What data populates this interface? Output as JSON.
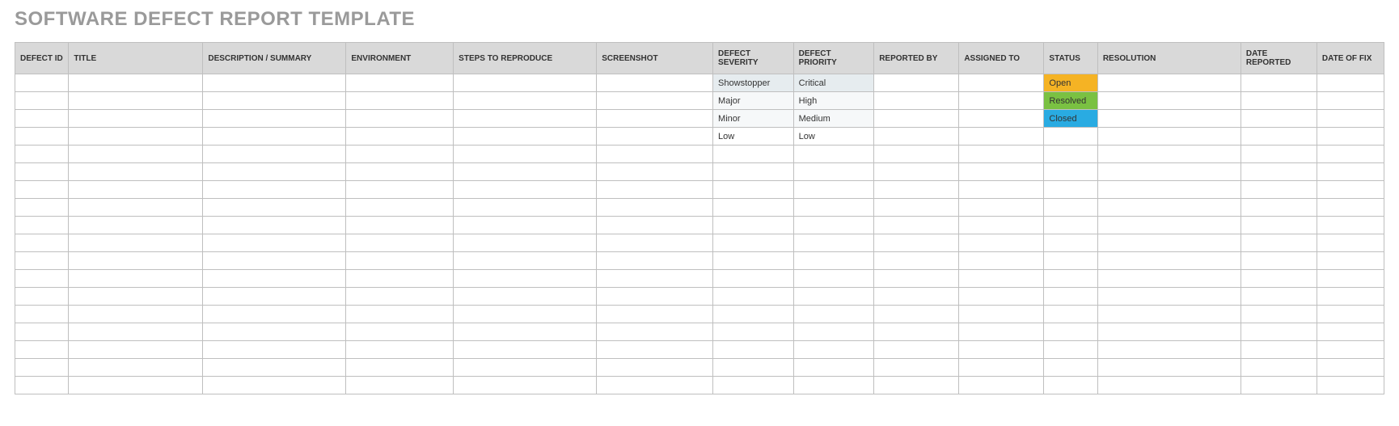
{
  "title": "SOFTWARE DEFECT REPORT TEMPLATE",
  "columns": [
    "DEFECT ID",
    "TITLE",
    "DESCRIPTION / SUMMARY",
    "ENVIRONMENT",
    "STEPS TO REPRODUCE",
    "SCREENSHOT",
    "DEFECT SEVERITY",
    "DEFECT PRIORITY",
    "REPORTED BY",
    "ASSIGNED TO",
    "STATUS",
    "RESOLUTION",
    "DATE REPORTED",
    "DATE OF FIX"
  ],
  "rows": [
    {
      "severity": "Showstopper",
      "priority": "Critical",
      "status": "Open",
      "status_class": "status-open",
      "sev_class": "sev-bg",
      "pri_class": "sev-bg"
    },
    {
      "severity": "Major",
      "priority": "High",
      "status": "Resolved",
      "status_class": "status-resolved",
      "sev_class": "sev-bg-light",
      "pri_class": "sev-bg-light"
    },
    {
      "severity": "Minor",
      "priority": "Medium",
      "status": "Closed",
      "status_class": "status-closed",
      "sev_class": "sev-bg-light",
      "pri_class": "sev-bg-light"
    },
    {
      "severity": "Low",
      "priority": "Low",
      "status": "",
      "status_class": "",
      "sev_class": "",
      "pri_class": ""
    },
    {},
    {},
    {},
    {},
    {},
    {},
    {},
    {},
    {},
    {},
    {},
    {},
    {},
    {}
  ]
}
